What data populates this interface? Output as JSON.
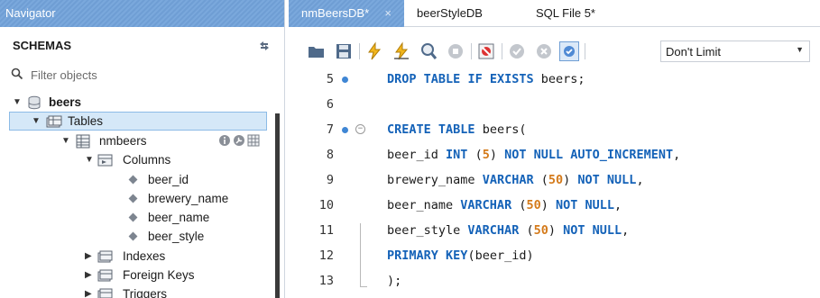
{
  "navigator": {
    "title": "Navigator",
    "schemas_label": "SCHEMAS",
    "filter_placeholder": "Filter objects",
    "tree": {
      "schema": "beers",
      "tables_folder": "Tables",
      "table": "nmbeers",
      "columns_folder": "Columns",
      "columns": [
        "beer_id",
        "brewery_name",
        "beer_name",
        "beer_style"
      ],
      "indexes_folder": "Indexes",
      "foreign_keys_folder": "Foreign Keys",
      "triggers_folder": "Triggers"
    }
  },
  "editor": {
    "tabs": [
      {
        "label": "nmBeersDB*",
        "active": true,
        "close": "×"
      },
      {
        "label": "beerStyleDB",
        "active": false
      },
      {
        "label": "SQL File 5*",
        "active": false
      }
    ],
    "limit_select": "Don't Limit",
    "lines": [
      {
        "n": "5",
        "text": "DROP TABLE IF EXISTS beers;"
      },
      {
        "n": "6",
        "text": ""
      },
      {
        "n": "7",
        "text": "CREATE TABLE beers("
      },
      {
        "n": "8",
        "text": "beer_id INT (5) NOT NULL AUTO_INCREMENT,"
      },
      {
        "n": "9",
        "text": "brewery_name VARCHAR (50) NOT NULL,"
      },
      {
        "n": "10",
        "text": "beer_name VARCHAR (50) NOT NULL,"
      },
      {
        "n": "11",
        "text": "beer_style VARCHAR (50) NOT NULL,"
      },
      {
        "n": "12",
        "text": "PRIMARY KEY(beer_id)"
      },
      {
        "n": "13",
        "text": ");"
      }
    ]
  },
  "colors": {
    "accent": "#7aa8dc",
    "keyword": "#1462b8",
    "number": "#d47a1a",
    "selection": "#d5e8f8"
  }
}
